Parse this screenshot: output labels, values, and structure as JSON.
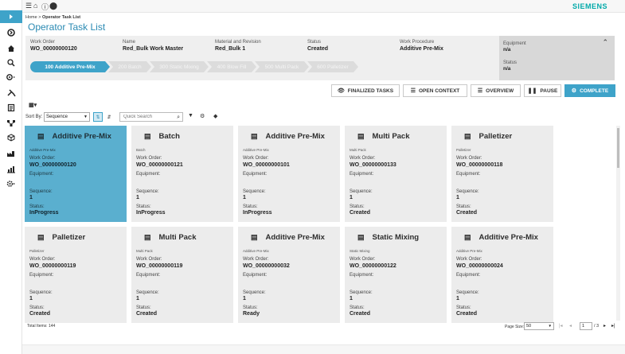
{
  "app": {
    "brand": "SIEMENS"
  },
  "breadcrumb": {
    "home": "Home",
    "separator": ">",
    "current": "Operator Task List"
  },
  "page_title": "Operator Task List",
  "header": {
    "work_order": {
      "label": "Work Order",
      "value": "WO_00000000120"
    },
    "name": {
      "label": "Name",
      "value": "Red_Bulk Work Master"
    },
    "material": {
      "label": "Material and Revision",
      "value": "Red_Bulk 1"
    },
    "status": {
      "label": "Status",
      "value": "Created"
    },
    "work_procedure": {
      "label": "Work Procedure",
      "value": "Additive Pre-Mix"
    },
    "equipment": {
      "label": "Equipment",
      "value": "n/a"
    },
    "equip_status": {
      "label": "Status",
      "value": "n/a"
    }
  },
  "steps": [
    {
      "label": "100 Additive Pre-Mix",
      "active": true
    },
    {
      "label": "200 Batch",
      "active": false
    },
    {
      "label": "300 Static Mixing",
      "active": false
    },
    {
      "label": "400 Blow Fill",
      "active": false
    },
    {
      "label": "500 Multi Pack",
      "active": false
    },
    {
      "label": "600 Palletizer",
      "active": false
    }
  ],
  "actions": {
    "finalized": "FINALIZED TASKS",
    "open_context": "OPEN CONTEXT",
    "overview": "OVERVIEW",
    "pause": "PAUSE",
    "complete": "COMPLETE"
  },
  "toolbar": {
    "sort_label": "Sort By:",
    "sort_value": "Sequence",
    "search_placeholder": "Quick Search"
  },
  "card_labels": {
    "work_order": "Work Order:",
    "equipment": "Equipment:",
    "sequence": "Sequence:",
    "status": "Status:"
  },
  "cards": [
    {
      "title": "Additive Pre-Mix",
      "subtitle": "Additive Pre-Mix",
      "work_order": "WO_00000000120",
      "sequence": "1",
      "status": "InProgress",
      "selected": true
    },
    {
      "title": "Batch",
      "subtitle": "Batch",
      "work_order": "WO_00000000121",
      "sequence": "1",
      "status": "InProgress",
      "selected": false
    },
    {
      "title": "Additive Pre-Mix",
      "subtitle": "Additive Pre-Mix",
      "work_order": "WO_00000000101",
      "sequence": "1",
      "status": "InProgress",
      "selected": false
    },
    {
      "title": "Multi Pack",
      "subtitle": "Multi Pack",
      "work_order": "WO_00000000133",
      "sequence": "1",
      "status": "Created",
      "selected": false
    },
    {
      "title": "Palletizer",
      "subtitle": "Palletizer",
      "work_order": "WO_00000000118",
      "sequence": "1",
      "status": "Created",
      "selected": false
    },
    {
      "title": "Palletizer",
      "subtitle": "Palletizer",
      "work_order": "WO_00000000119",
      "sequence": "1",
      "status": "Created",
      "selected": false
    },
    {
      "title": "Multi Pack",
      "subtitle": "Multi Pack",
      "work_order": "WO_00000000119",
      "sequence": "1",
      "status": "Created",
      "selected": false
    },
    {
      "title": "Additive Pre-Mix",
      "subtitle": "Additive Pre-Mix",
      "work_order": "WO_00000000032",
      "sequence": "1",
      "status": "Ready",
      "selected": false
    },
    {
      "title": "Static Mixing",
      "subtitle": "Static Mixing",
      "work_order": "WO_00000000122",
      "sequence": "1",
      "status": "Created",
      "selected": false
    },
    {
      "title": "Additive Pre-Mix",
      "subtitle": "Additive Pre-Mix",
      "work_order": "WO_00000000024",
      "sequence": "1",
      "status": "Created",
      "selected": false
    }
  ],
  "footer": {
    "total": "Total Items: 144",
    "page_size_label": "Page Size:",
    "page_size": "50",
    "page": "1",
    "page_total": "/ 3"
  },
  "icons": {
    "sidebar": [
      "expand-icon",
      "home-icon",
      "search-icon",
      "settings-icon",
      "tools-icon",
      "clipboard-icon",
      "hierarchy-icon",
      "cube-icon",
      "factory-icon",
      "chart-icon",
      "gear-icon"
    ]
  },
  "colors": {
    "accent": "#3ea3c9",
    "brand": "#00a9a9",
    "card": "#ececec",
    "card_selected": "#5aafcf"
  }
}
